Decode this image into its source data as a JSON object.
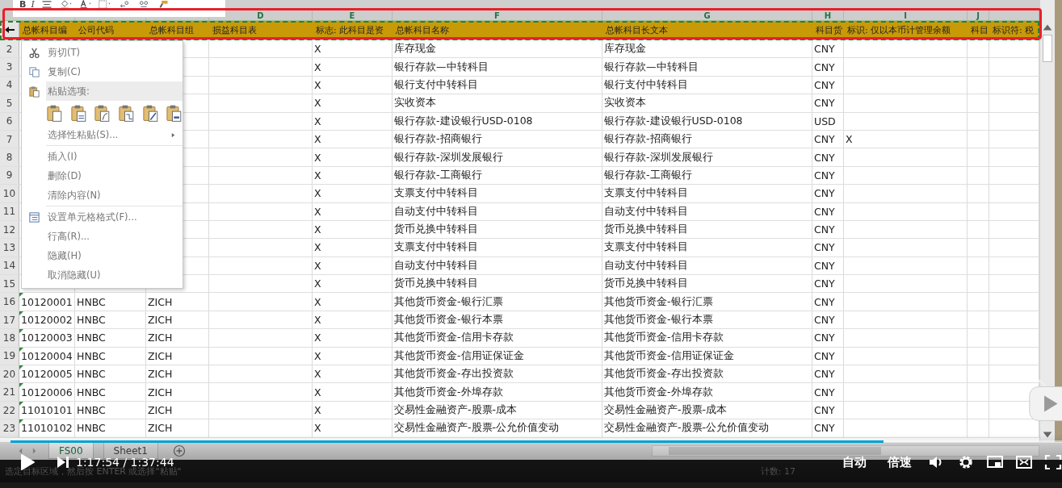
{
  "mini_toolbar": {
    "bold": "B",
    "italic": "I"
  },
  "columns": [
    {
      "heading": "总帐科目编"
    },
    {
      "heading": "公司代码"
    },
    {
      "heading": "总帐科目组"
    },
    {
      "letter": "D",
      "heading": "损益科目表"
    },
    {
      "letter": "E",
      "heading": "标志: 此科目是资"
    },
    {
      "letter": "F",
      "heading": "总帐科目名称"
    },
    {
      "letter": "G",
      "heading": "总帐科目长文本"
    },
    {
      "letter": "H",
      "heading": "科目货"
    },
    {
      "letter": "I",
      "heading": "标识: 仅以本币计管理余额"
    },
    {
      "letter": "J",
      "heading": "科目"
    },
    {
      "heading": "标识符: 税"
    }
  ],
  "header_row": {
    "copied": true
  },
  "rows": [
    {
      "number": "2",
      "number_as_text": false,
      "E": "X",
      "F": "库存现金",
      "G": "库存现金",
      "H": "CNY"
    },
    {
      "number": "3",
      "number_as_text": false,
      "E": "X",
      "F": "银行存款—中转科目",
      "G": "银行存款—中转科目",
      "H": "CNY"
    },
    {
      "number": "4",
      "number_as_text": false,
      "E": "X",
      "F": "银行支付中转科目",
      "G": "银行支付中转科目",
      "H": "CNY"
    },
    {
      "number": "5",
      "number_as_text": false,
      "E": "X",
      "F": "实收资本",
      "G": "实收资本",
      "H": "CNY"
    },
    {
      "number": "6",
      "number_as_text": false,
      "E": "X",
      "F": "银行存款-建设银行USD-0108",
      "G": "银行存款-建设银行USD-0108",
      "H": "USD"
    },
    {
      "number": "7",
      "number_as_text": false,
      "E": "X",
      "F": "银行存款-招商银行",
      "G": "银行存款-招商银行",
      "H": "CNY",
      "I": "X"
    },
    {
      "number": "8",
      "number_as_text": false,
      "E": "X",
      "F": "银行存款-深圳发展银行",
      "G": "银行存款-深圳发展银行",
      "H": "CNY"
    },
    {
      "number": "9",
      "number_as_text": false,
      "E": "X",
      "F": "银行存款-工商银行",
      "G": "银行存款-工商银行",
      "H": "CNY"
    },
    {
      "number": "10",
      "number_as_text": false,
      "E": "X",
      "F": "支票支付中转科目",
      "G": "支票支付中转科目",
      "H": "CNY"
    },
    {
      "number": "11",
      "number_as_text": false,
      "E": "X",
      "F": "自动支付中转科目",
      "G": "自动支付中转科目",
      "H": "CNY"
    },
    {
      "number": "12",
      "number_as_text": false,
      "E": "X",
      "F": "货币兑换中转科目",
      "G": "货币兑换中转科目",
      "H": "CNY"
    },
    {
      "number": "13",
      "number_as_text": false,
      "E": "X",
      "F": "支票支付中转科目",
      "G": "支票支付中转科目",
      "H": "CNY"
    },
    {
      "number": "14",
      "number_as_text": false,
      "E": "X",
      "F": "自动支付中转科目",
      "G": "自动支付中转科目",
      "H": "CNY"
    },
    {
      "number": "15",
      "number_as_text": false,
      "E": "X",
      "F": "货币兑换中转科目",
      "G": "货币兑换中转科目",
      "H": "CNY"
    },
    {
      "number": "16",
      "number_as_text": true,
      "A": "10120001",
      "B": "HNBC",
      "C": "ZICH",
      "E": "X",
      "F": "其他货币资金-银行汇票",
      "G": "其他货币资金-银行汇票",
      "H": "CNY"
    },
    {
      "number": "17",
      "number_as_text": true,
      "A": "10120002",
      "B": "HNBC",
      "C": "ZICH",
      "E": "X",
      "F": "其他货币资金-银行本票",
      "G": "其他货币资金-银行本票",
      "H": "CNY"
    },
    {
      "number": "18",
      "number_as_text": true,
      "A": "10120003",
      "B": "HNBC",
      "C": "ZICH",
      "E": "X",
      "F": "其他货币资金-信用卡存款",
      "G": "其他货币资金-信用卡存款",
      "H": "CNY"
    },
    {
      "number": "19",
      "number_as_text": true,
      "A": "10120004",
      "B": "HNBC",
      "C": "ZICH",
      "E": "X",
      "F": "其他货币资金-信用证保证金",
      "G": "其他货币资金-信用证保证金",
      "H": "CNY"
    },
    {
      "number": "20",
      "number_as_text": true,
      "A": "10120005",
      "B": "HNBC",
      "C": "ZICH",
      "E": "X",
      "F": "其他货币资金-存出投资款",
      "G": "其他货币资金-存出投资款",
      "H": "CNY"
    },
    {
      "number": "21",
      "number_as_text": true,
      "A": "10120006",
      "B": "HNBC",
      "C": "ZICH",
      "E": "X",
      "F": "其他货币资金-外埠存款",
      "G": "其他货币资金-外埠存款",
      "H": "CNY"
    },
    {
      "number": "22",
      "number_as_text": true,
      "A": "11010101",
      "B": "HNBC",
      "C": "ZICH",
      "E": "X",
      "F": "交易性金融资产-股票-成本",
      "G": "交易性金融资产-股票-成本",
      "H": "CNY"
    },
    {
      "number": "23",
      "number_as_text": true,
      "A": "11010102",
      "B": "HNBC",
      "C": "ZICH",
      "E": "X",
      "F": "交易性金融资产-股票-公允价值变动",
      "G": "交易性金融资产-股票-公允价值变动",
      "H": "CNY"
    }
  ],
  "context_menu": {
    "groups": [
      [
        {
          "kind": "command",
          "label": "剪切(T)",
          "submenu": false
        },
        {
          "kind": "command",
          "label": "复制(C)",
          "submenu": false
        },
        {
          "kind": "heading",
          "label": "粘贴选项:"
        },
        {
          "kind": "paste-options"
        },
        {
          "kind": "command",
          "label": "选择性粘贴(S)...",
          "submenu": true
        }
      ],
      [
        {
          "kind": "command",
          "label": "插入(I)",
          "submenu": false
        },
        {
          "kind": "command",
          "label": "删除(D)",
          "submenu": false
        },
        {
          "kind": "command",
          "label": "清除内容(N)",
          "submenu": false
        }
      ],
      [
        {
          "kind": "command",
          "label": "设置单元格格式(F)...",
          "submenu": false
        },
        {
          "kind": "command",
          "label": "行高(R)...",
          "submenu": false
        },
        {
          "kind": "command",
          "label": "隐藏(H)",
          "submenu": false
        },
        {
          "kind": "command",
          "label": "取消隐藏(U)",
          "submenu": false
        }
      ]
    ]
  },
  "sheet_tabs": [
    {
      "label": "FS00",
      "selected": true
    },
    {
      "label": "Sheet1",
      "selected": false
    }
  ],
  "status_bar": {
    "message": "选定目标区域，然后按 ENTER 或选择\"粘贴\"",
    "count": "计数: 17"
  },
  "player": {
    "progress": {
      "level": 0.83
    },
    "time": "1:17:54 / 1:37:44",
    "buttons": [
      "自动",
      "倍速"
    ]
  }
}
